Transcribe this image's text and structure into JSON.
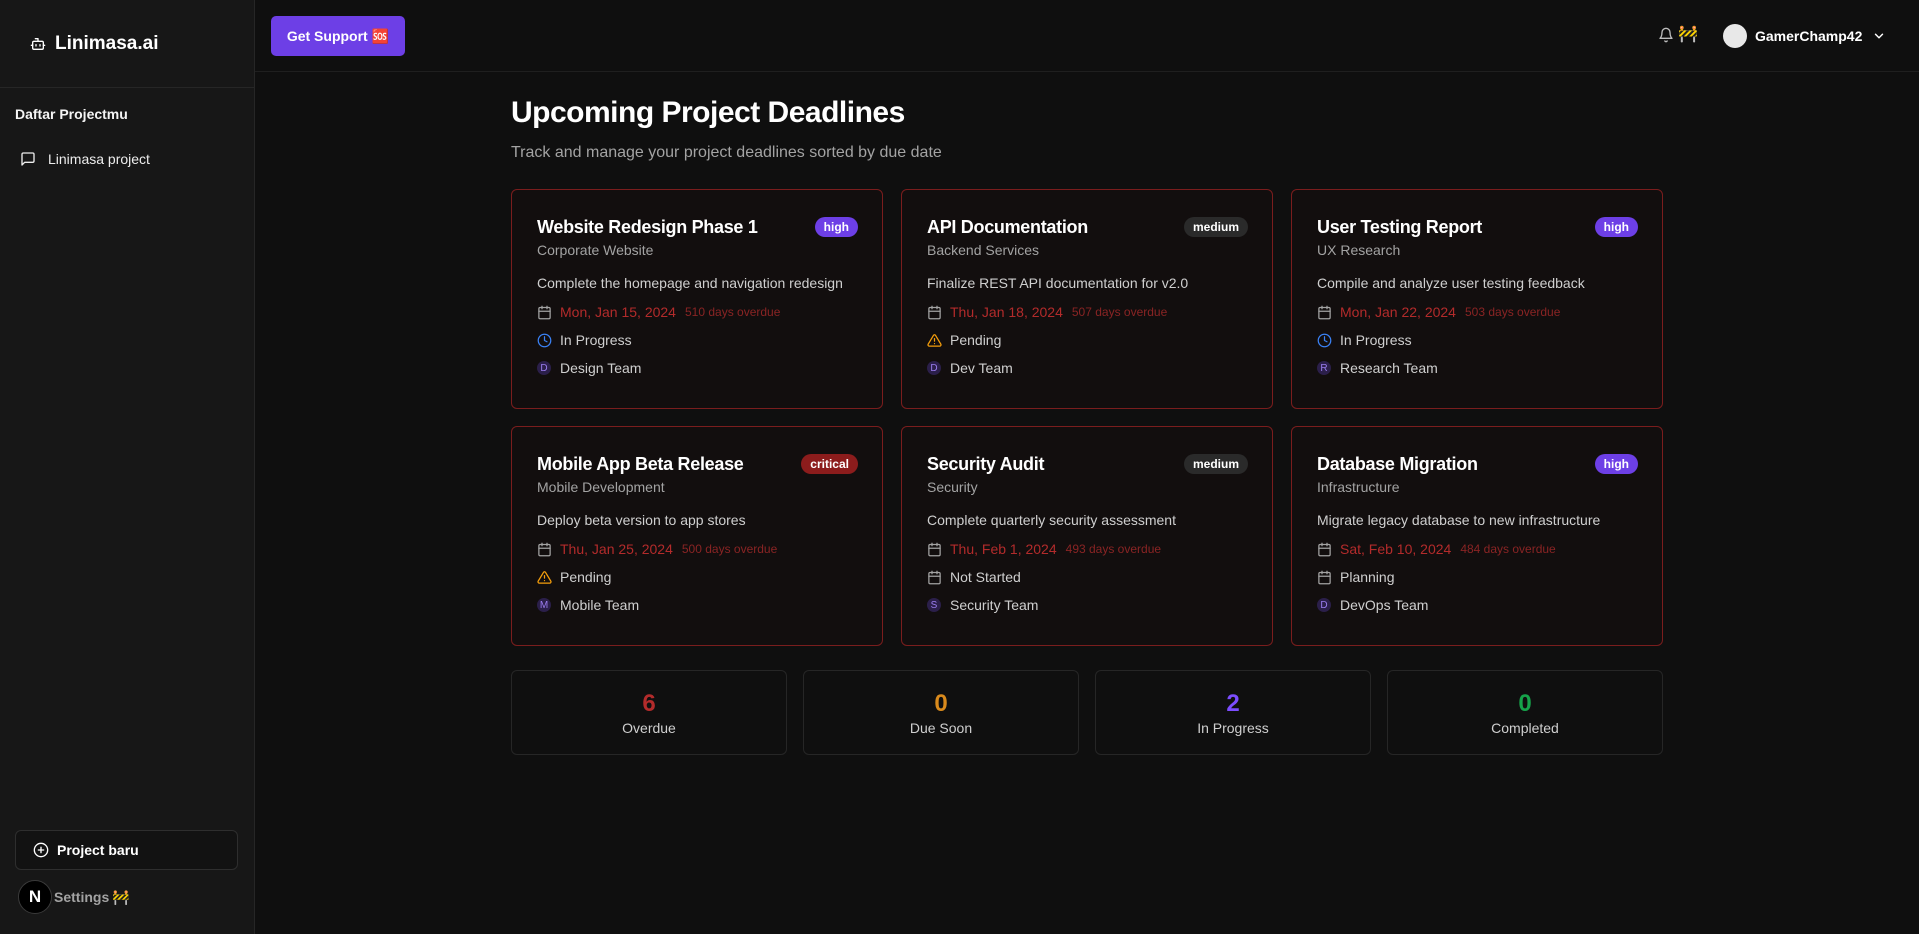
{
  "app": {
    "name": "Linimasa.ai"
  },
  "sidebar": {
    "section_title": "Daftar Projectmu",
    "projects": [
      {
        "label": "Linimasa project"
      }
    ],
    "new_project_label": "Project baru",
    "settings_label": "Settings",
    "logo_letter": "N",
    "construction_emoji": "🚧"
  },
  "header": {
    "support_label": "Get Support",
    "support_emoji": "🆘",
    "construction_emoji": "🚧",
    "username": "GamerChamp42"
  },
  "main": {
    "title": "Upcoming Project Deadlines",
    "subtitle": "Track and manage your project deadlines sorted by due date"
  },
  "cards": [
    {
      "title": "Website Redesign Phase 1",
      "priority": "high",
      "project": "Corporate Website",
      "description": "Complete the homepage and navigation redesign",
      "date": "Mon, Jan 15, 2024",
      "overdue": "510 days overdue",
      "status": "In Progress",
      "status_icon": "clock-icon",
      "team_initial": "D",
      "team": "Design Team"
    },
    {
      "title": "API Documentation",
      "priority": "medium",
      "project": "Backend Services",
      "description": "Finalize REST API documentation for v2.0",
      "date": "Thu, Jan 18, 2024",
      "overdue": "507 days overdue",
      "status": "Pending",
      "status_icon": "warning-icon",
      "team_initial": "D",
      "team": "Dev Team"
    },
    {
      "title": "User Testing Report",
      "priority": "high",
      "project": "UX Research",
      "description": "Compile and analyze user testing feedback",
      "date": "Mon, Jan 22, 2024",
      "overdue": "503 days overdue",
      "status": "In Progress",
      "status_icon": "clock-icon",
      "team_initial": "R",
      "team": "Research Team"
    },
    {
      "title": "Mobile App Beta Release",
      "priority": "critical",
      "project": "Mobile Development",
      "description": "Deploy beta version to app stores",
      "date": "Thu, Jan 25, 2024",
      "overdue": "500 days overdue",
      "status": "Pending",
      "status_icon": "warning-icon",
      "team_initial": "M",
      "team": "Mobile Team"
    },
    {
      "title": "Security Audit",
      "priority": "medium",
      "project": "Security",
      "description": "Complete quarterly security assessment",
      "date": "Thu, Feb 1, 2024",
      "overdue": "493 days overdue",
      "status": "Not Started",
      "status_icon": "calendar-icon",
      "team_initial": "S",
      "team": "Security Team"
    },
    {
      "title": "Database Migration",
      "priority": "high",
      "project": "Infrastructure",
      "description": "Migrate legacy database to new infrastructure",
      "date": "Sat, Feb 10, 2024",
      "overdue": "484 days overdue",
      "status": "Planning",
      "status_icon": "calendar-icon",
      "team_initial": "D",
      "team": "DevOps Team"
    }
  ],
  "stats": [
    {
      "value": "6",
      "label": "Overdue",
      "color": "#b32b2b"
    },
    {
      "value": "0",
      "label": "Due Soon",
      "color": "#d98a1c"
    },
    {
      "value": "2",
      "label": "In Progress",
      "color": "#7c4dff"
    },
    {
      "value": "0",
      "label": "Completed",
      "color": "#16a34a"
    }
  ],
  "colors": {
    "accent": "#6d3fe6",
    "overdue_red": "#b32b2b",
    "card_border": "#7a1d1d",
    "clock_blue": "#3b82f6",
    "warning_amber": "#f59e0b"
  }
}
